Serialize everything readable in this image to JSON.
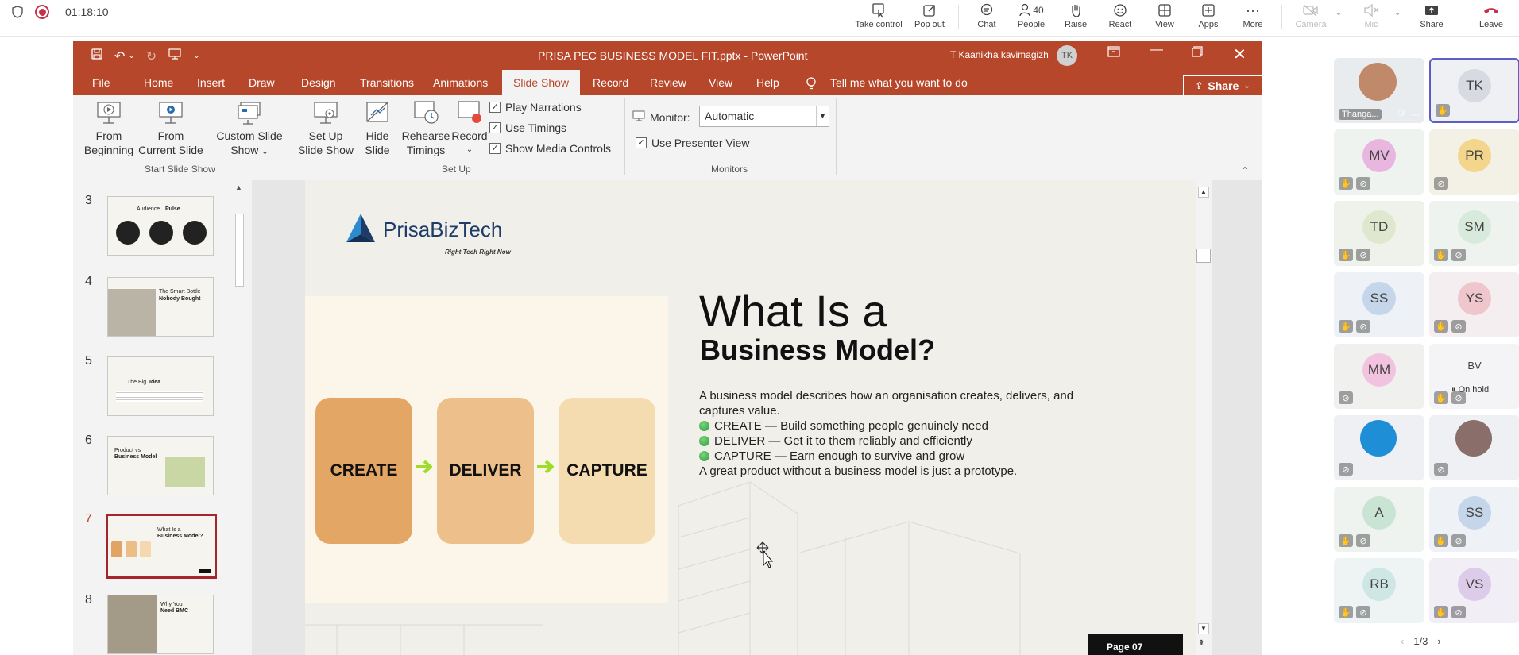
{
  "meeting": {
    "timer": "01:18:10",
    "people_count": "40",
    "tools": {
      "take_control": "Take control",
      "pop_out": "Pop out",
      "chat": "Chat",
      "people": "People",
      "raise": "Raise",
      "react": "React",
      "view": "View",
      "apps": "Apps",
      "more": "More",
      "camera": "Camera",
      "mic": "Mic",
      "share": "Share",
      "leave": "Leave"
    },
    "leave_color": "#c4314b"
  },
  "ppt": {
    "doc_title": "PRISA PEC BUSINESS MODEL FIT.pptx  -  PowerPoint",
    "user_name": "T Kaanikha kavimagizh",
    "user_initials": "TK",
    "accent": "#b7472a",
    "tabs": [
      "File",
      "Home",
      "Insert",
      "Draw",
      "Design",
      "Transitions",
      "Animations",
      "Slide Show",
      "Record",
      "Review",
      "View",
      "Help"
    ],
    "active_tab": "Slide Show",
    "tell_me": "Tell me what you want to do",
    "share_label": "Share",
    "ribbon": {
      "from_beginning_1": "From",
      "from_beginning_2": "Beginning",
      "from_current_1": "From",
      "from_current_2": "Current Slide",
      "custom_1": "Custom Slide",
      "custom_2": "Show",
      "group_start": "Start Slide Show",
      "setup_1": "Set Up",
      "setup_2": "Slide Show",
      "hide_1": "Hide",
      "hide_2": "Slide",
      "rehearse_1": "Rehearse",
      "rehearse_2": "Timings",
      "record": "Record",
      "play_narrations": "Play Narrations",
      "use_timings": "Use Timings",
      "show_media_controls": "Show Media Controls",
      "group_setup": "Set Up",
      "monitor_label": "Monitor:",
      "monitor_value": "Automatic",
      "use_presenter_view": "Use Presenter View",
      "group_monitors": "Monitors"
    },
    "thumbnails": [
      {
        "num": "3",
        "text_a": "Audience",
        "text_b": "Pulse"
      },
      {
        "num": "4",
        "text_a": "The Smart Bottle",
        "text_b": "Nobody Bought"
      },
      {
        "num": "5",
        "text_a": "The Big",
        "text_b": "Idea"
      },
      {
        "num": "6",
        "text_a": "Product vs",
        "text_b": "Business Model"
      },
      {
        "num": "7",
        "text_a": "What Is a",
        "text_b": "Business Model?"
      },
      {
        "num": "8",
        "text_a": "Why You",
        "text_b": "Need BMC"
      }
    ],
    "selected_slide": "7",
    "slide": {
      "logo_text": "PrisaBizTech",
      "tagline": "Right Tech Right Now",
      "box1": "CREATE",
      "box2": "DELIVER",
      "box3": "CAPTURE",
      "heading_1": "What Is a",
      "heading_2": "Business Model?",
      "intro": "A business model describes how an organisation creates, delivers, and captures value.",
      "bullet_1": "CREATE — Build something people genuinely need",
      "bullet_2": "DELIVER — Get it to them reliably and efficiently",
      "bullet_3": "CAPTURE — Earn enough to survive and grow",
      "closing": "A great product without a business model is just a prototype.",
      "page_label": "Page 07"
    }
  },
  "participants": {
    "tiles": [
      {
        "initials": "",
        "name": "Thanga...",
        "kind": "photo"
      },
      {
        "initials": "TK",
        "name": "",
        "kind": "avatar"
      },
      {
        "initials": "MV",
        "name": "",
        "kind": "avatar"
      },
      {
        "initials": "PR",
        "name": "",
        "kind": "avatar"
      },
      {
        "initials": "TD",
        "name": "",
        "kind": "avatar"
      },
      {
        "initials": "SM",
        "name": "",
        "kind": "avatar"
      },
      {
        "initials": "SS",
        "name": "",
        "kind": "avatar"
      },
      {
        "initials": "YS",
        "name": "",
        "kind": "avatar"
      },
      {
        "initials": "MM",
        "name": "",
        "kind": "avatar"
      },
      {
        "initials": "BV",
        "name": "",
        "kind": "avatar"
      },
      {
        "initials": "",
        "name": "",
        "kind": "photo"
      },
      {
        "initials": "",
        "name": "",
        "kind": "photo"
      },
      {
        "initials": "A",
        "name": "",
        "kind": "avatar"
      },
      {
        "initials": "SS",
        "name": "",
        "kind": "avatar"
      },
      {
        "initials": "RB",
        "name": "",
        "kind": "avatar"
      },
      {
        "initials": "VS",
        "name": "",
        "kind": "avatar"
      }
    ],
    "on_hold": "On hold",
    "page": "1/3"
  }
}
